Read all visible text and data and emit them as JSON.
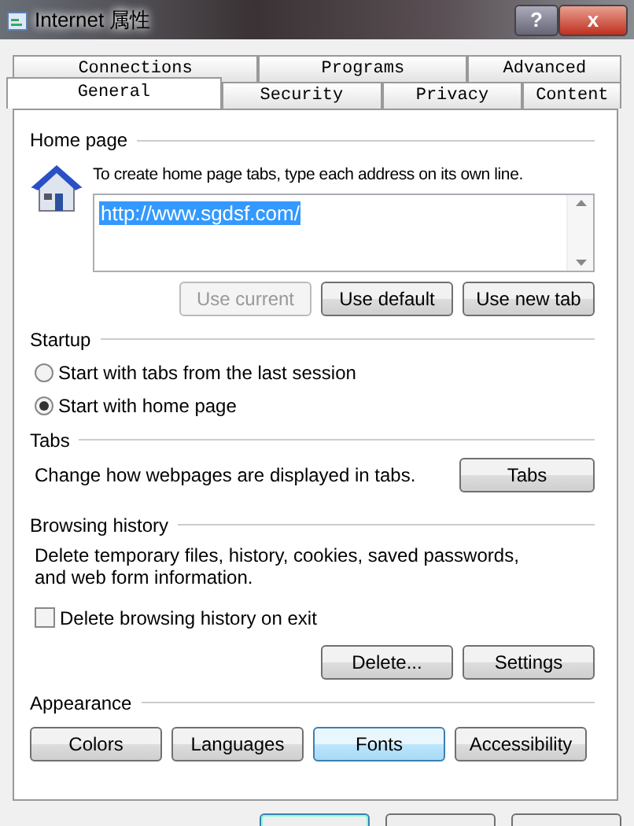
{
  "window": {
    "title": "Internet 属性",
    "buttons": [
      "?",
      "x"
    ]
  },
  "tab_rows": [
    [
      {
        "label": "Connections",
        "selected": false
      },
      {
        "label": "Programs",
        "selected": false
      },
      {
        "label": "Advanced",
        "selected": false
      }
    ],
    [
      {
        "label": "General",
        "selected": true
      },
      {
        "label": "Security",
        "selected": false
      },
      {
        "label": "Privacy",
        "selected": false
      },
      {
        "label": "Content",
        "selected": false
      }
    ]
  ],
  "home_page": {
    "title": "Home page",
    "hint": "To create home page tabs, type each address on its own line.",
    "value": "http://www.sgdsf.com/",
    "buttons": [
      {
        "label": "Use current",
        "disabled": true
      },
      {
        "label": "Use default",
        "disabled": false
      },
      {
        "label": "Use new tab",
        "disabled": false
      }
    ]
  },
  "startup": {
    "title": "Startup",
    "options": [
      {
        "label": "Start with tabs from the last session",
        "selected": false
      },
      {
        "label": "Start with home page",
        "selected": true
      }
    ]
  },
  "tabs_section": {
    "title": "Tabs",
    "text": "Change how webpages are displayed in tabs.",
    "button": "Tabs"
  },
  "browsing_history": {
    "title": "Browsing history",
    "text": "Delete temporary files, history, cookies, saved passwords, and web form information.",
    "checkbox": {
      "label": "Delete browsing history on exit",
      "checked": false
    },
    "buttons": [
      "Delete...",
      "Settings"
    ]
  },
  "appearance": {
    "title": "Appearance",
    "buttons": [
      {
        "label": "Colors",
        "hover": false
      },
      {
        "label": "Languages",
        "hover": false
      },
      {
        "label": "Fonts",
        "hover": true
      },
      {
        "label": "Accessibility",
        "hover": false
      }
    ]
  },
  "dialog_buttons": [
    {
      "default": true
    },
    {
      "default": false
    },
    {
      "default": false
    }
  ]
}
